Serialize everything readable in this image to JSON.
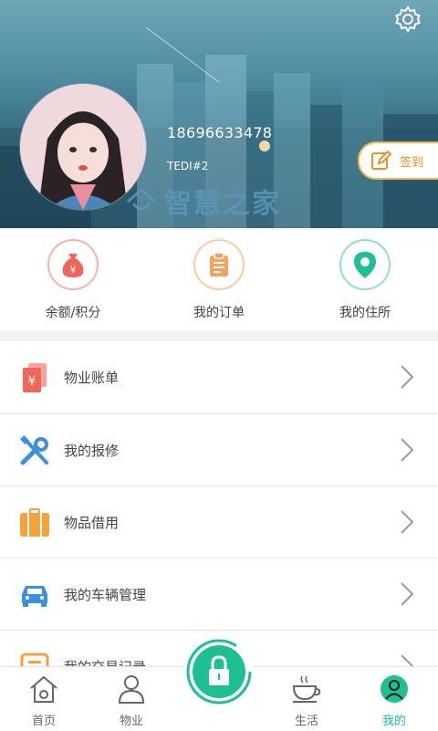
{
  "header": {
    "phone": "18696633478",
    "nickname": "TEDI#2",
    "watermark": "智慧之家",
    "signin_label": "签到",
    "settings_icon": "gear-icon",
    "colors": {
      "accent": "#f4b24c"
    }
  },
  "quick_menu": [
    {
      "label": "余额/积分",
      "icon": "money-bag-icon",
      "color": "#f0655a"
    },
    {
      "label": "我的订单",
      "icon": "clipboard-icon",
      "color": "#f5a25a"
    },
    {
      "label": "我的住所",
      "icon": "location-pin-icon",
      "color": "#1fbf94"
    }
  ],
  "list": [
    {
      "label": "物业账单",
      "icon": "bill-icon",
      "color": "#f0655a"
    },
    {
      "label": "我的报修",
      "icon": "tools-icon",
      "color": "#3a8fe0"
    },
    {
      "label": "物品借用",
      "icon": "suitcase-icon",
      "color": "#f5a23a"
    },
    {
      "label": "我的车辆管理",
      "icon": "car-icon",
      "color": "#3a8fe0"
    },
    {
      "label": "我的交易记录",
      "icon": "record-icon",
      "color": "#f5a23a"
    }
  ],
  "nav": [
    {
      "label": "首页",
      "icon": "home-icon"
    },
    {
      "label": "物业",
      "icon": "person-icon"
    },
    {
      "label": "",
      "icon": "lock-icon",
      "color": "#1fbf94"
    },
    {
      "label": "生活",
      "icon": "coffee-icon"
    },
    {
      "label": "我的",
      "icon": "profile-icon",
      "active": true
    }
  ]
}
